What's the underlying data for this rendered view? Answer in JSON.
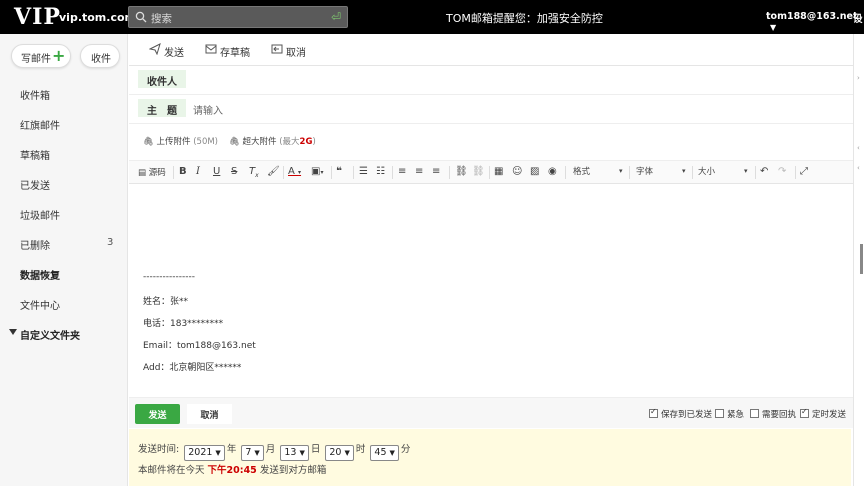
{
  "header": {
    "logo": "VIP",
    "domain": "vip.tom.com",
    "search_placeholder": "搜索",
    "notice": "TOM邮箱提醒您：加强安全防控",
    "account": "tom188@163.net",
    "settings_label": "设"
  },
  "sidebar": {
    "compose_label": "写邮件",
    "receive_label": "收件",
    "items": [
      {
        "label": "收件箱",
        "count": ""
      },
      {
        "label": "红旗邮件",
        "count": ""
      },
      {
        "label": "草稿箱",
        "count": ""
      },
      {
        "label": "已发送",
        "count": ""
      },
      {
        "label": "垃圾邮件",
        "count": ""
      },
      {
        "label": "已删除",
        "count": "3"
      },
      {
        "label": "数据恢复",
        "count": ""
      },
      {
        "label": "文件中心",
        "count": ""
      }
    ],
    "custom_folder": "自定义文件夹"
  },
  "toolbar": {
    "send": "发送",
    "save_draft": "存草稿",
    "cancel": "取消"
  },
  "compose": {
    "recipient_label": "收件人",
    "subject_label": "主　题",
    "subject_placeholder": "请输入",
    "upload_label": "上传附件",
    "upload_limit": "(50M)",
    "large_label": "超大附件",
    "large_limit_prefix": "(最大",
    "large_limit_value": "2G",
    "large_limit_suffix": ")"
  },
  "editor_toolbar": {
    "source": "源码",
    "format": "格式",
    "font": "字体",
    "size": "大小"
  },
  "body": {
    "divider": "----------------",
    "name": "姓名：张**",
    "phone": "电话：183********",
    "email": "Email：tom188@163.net",
    "address": "Add：北京朝阳区******"
  },
  "sendbar": {
    "send": "发送",
    "cancel": "取消",
    "options": [
      {
        "label": "保存到已发送",
        "checked": true
      },
      {
        "label": "紧急",
        "checked": false
      },
      {
        "label": "需要回执",
        "checked": false
      },
      {
        "label": "定时发送",
        "checked": true
      }
    ]
  },
  "timed_send": {
    "label": "发送时间:",
    "year": "2021",
    "year_unit": "年",
    "month": "7",
    "month_unit": "月",
    "day": "13",
    "day_unit": "日",
    "hour": "20",
    "hour_unit": "时",
    "minute": "45",
    "minute_unit": "分",
    "note_prefix": "本邮件将在今天",
    "note_time": "下午20:45",
    "note_suffix": "发送到对方邮箱"
  },
  "colors": {
    "accent": "#3aa843",
    "header_bg": "#000000",
    "highlight_red": "#cc0000",
    "timed_bg": "#fffbe0"
  }
}
